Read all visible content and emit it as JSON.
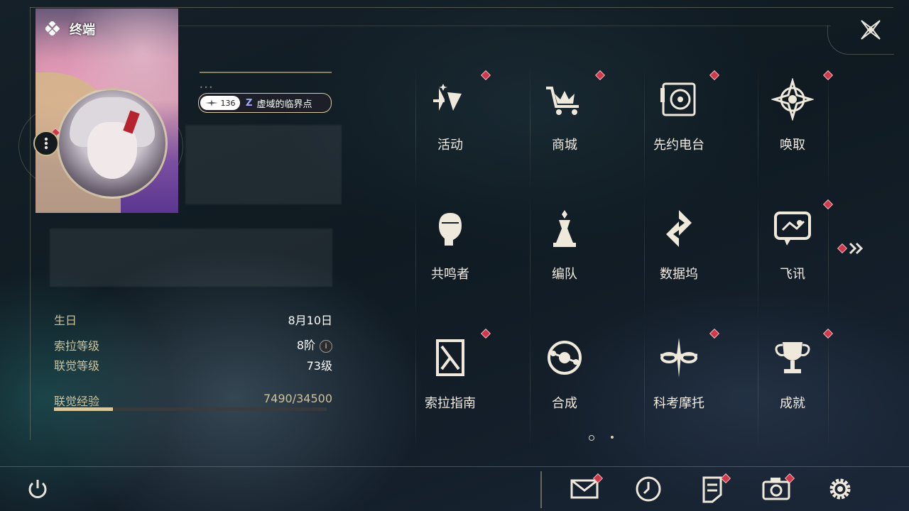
{
  "profile": {
    "banner_title": "终端",
    "level_badge": "136",
    "title_glyph": "Z",
    "title_text": "虚域的临界点"
  },
  "stats": [
    {
      "label": "生日",
      "value": "8月10日"
    },
    {
      "label": "索拉等级",
      "value": "8阶"
    },
    {
      "label": "联觉等级",
      "value": "73级"
    },
    {
      "label": "联觉经验",
      "value": "7490/34500"
    }
  ],
  "exp": {
    "current": 7490,
    "max": 34500
  },
  "info_glyph": "i",
  "menu": [
    {
      "label": "活动",
      "icon": "event-icon",
      "badge": true
    },
    {
      "label": "商城",
      "icon": "shop-cart-icon",
      "badge": true
    },
    {
      "label": "先约电台",
      "icon": "radio-icon",
      "badge": true
    },
    {
      "label": "唤取",
      "icon": "convene-compass-icon",
      "badge": true
    },
    {
      "label": "共鸣者",
      "icon": "resonator-head-icon",
      "badge": false
    },
    {
      "label": "编队",
      "icon": "team-chess-icon",
      "badge": false
    },
    {
      "label": "数据坞",
      "icon": "data-bank-icon",
      "badge": false
    },
    {
      "label": "飞讯",
      "icon": "message-bubble-icon",
      "badge": true
    },
    {
      "label": "索拉指南",
      "icon": "guide-book-icon",
      "badge": true
    },
    {
      "label": "合成",
      "icon": "synthesis-icon",
      "badge": false
    },
    {
      "label": "科考摩托",
      "icon": "motorcycle-icon",
      "badge": true
    },
    {
      "label": "成就",
      "icon": "trophy-icon",
      "badge": true
    }
  ],
  "bottom_bar": [
    {
      "name": "mail-button",
      "icon": "mail-icon",
      "badge": true
    },
    {
      "name": "clock-button",
      "icon": "clock-icon",
      "badge": false
    },
    {
      "name": "notice-button",
      "icon": "notice-icon",
      "badge": true
    },
    {
      "name": "camera-button",
      "icon": "camera-icon",
      "badge": true
    },
    {
      "name": "settings-button",
      "icon": "gear-icon",
      "badge": false
    }
  ],
  "colors": {
    "accent": "#d8c9a0",
    "badge": "#d0394a",
    "label": "#cfc39a"
  },
  "pager": {
    "pages": 2,
    "current": 1
  }
}
